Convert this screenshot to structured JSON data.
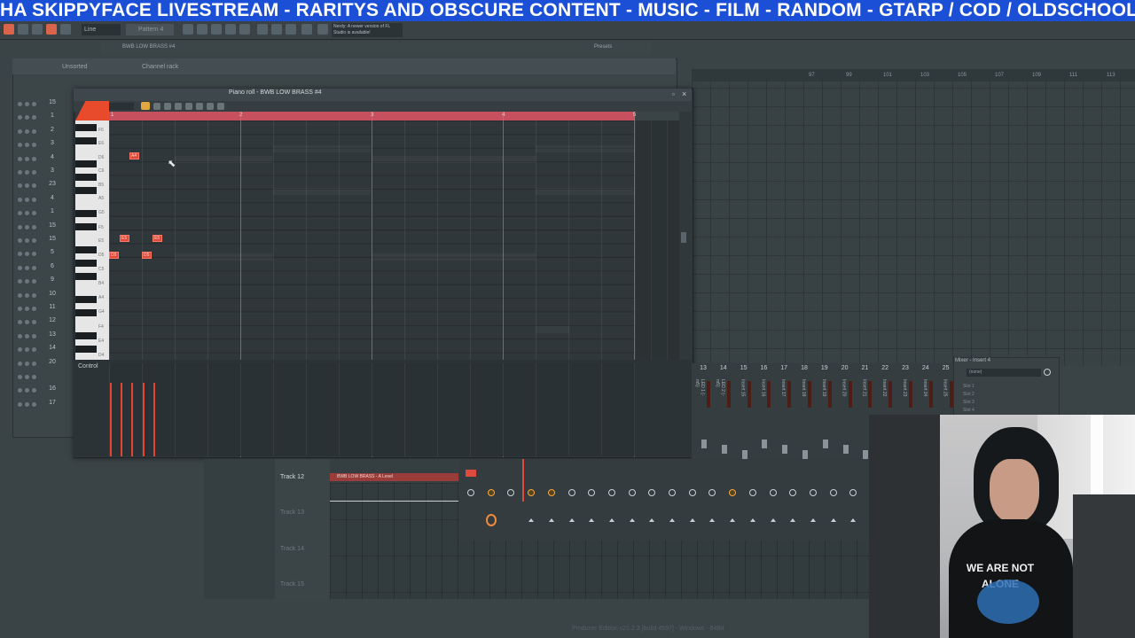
{
  "banner": {
    "text": "HA SKIPPYFACE LIVESTREAM  - RARITYS AND OBSCURE CONTENT - MUSIC - FILM - RANDOM - GTARP / COD / OLDSCHOOL CO"
  },
  "toolbar": {
    "pattern_label": "Pattern 4",
    "mode_label": "Line",
    "news_text": "Nerdy: A newer version of FL Studio is available!"
  },
  "channel_rack": {
    "title": "Channel rack",
    "filter": "Unsorted",
    "sample_window_title": "BWB LOW BRASS #4",
    "presets_label": "Presets",
    "row_numbers": [
      "15",
      "1",
      "2",
      "3",
      "4",
      "3",
      "23",
      "4",
      "1",
      "15",
      "15",
      "5",
      "6",
      "9",
      "10",
      "11",
      "12",
      "13",
      "14",
      "20",
      "",
      "16",
      "17"
    ]
  },
  "piano_roll": {
    "title": "Piano roll - BWB LOW BRASS #4",
    "bar_numbers": [
      "1",
      "2",
      "3",
      "4",
      "5"
    ],
    "key_labels": [
      "F6",
      "E6",
      "D6",
      "C6",
      "B5",
      "A5",
      "G5",
      "F5",
      "E5",
      "D5",
      "C5",
      "B4",
      "A4",
      "G4",
      "F4",
      "E4",
      "D4"
    ],
    "notes": [
      {
        "label": "A4",
        "pitch": "D6"
      },
      {
        "label": "E5",
        "pitch": "F5"
      },
      {
        "label": "E5",
        "pitch": "F5"
      },
      {
        "label": "D5",
        "pitch": "D5"
      },
      {
        "label": "D5",
        "pitch": "D5"
      }
    ],
    "control_label": "Control"
  },
  "mixer": {
    "title": "Mixer - Insert 4",
    "insert_numbers": [
      "13",
      "14",
      "15",
      "16",
      "17",
      "18",
      "19",
      "20",
      "21",
      "22",
      "23",
      "24",
      "25"
    ],
    "insert_labels": [
      "LED 1 (-m5)",
      "LED 2 (-m5)",
      "Insert 15",
      "Insert 16",
      "Insert 17",
      "Insert 18",
      "Insert 19",
      "Insert 20",
      "Insert 21",
      "Insert 22",
      "Insert 23",
      "Insert 24",
      "Insert 25"
    ],
    "slot_label": "(none)",
    "slots": [
      "Slot 1",
      "Slot 2",
      "Slot 3",
      "Slot 4"
    ]
  },
  "playlist": {
    "ruler_numbers": [
      "97",
      "99",
      "101",
      "103",
      "105",
      "107",
      "109",
      "111",
      "113"
    ],
    "tracks": [
      {
        "label": "Track 12",
        "active": true
      },
      {
        "label": "Track 13",
        "active": false
      },
      {
        "label": "Track 14",
        "active": false
      },
      {
        "label": "Track 15",
        "active": false
      }
    ],
    "clip_label": "BWB LOW BRASS - A Level"
  },
  "status_bar": {
    "text": "Producer Edition v21.2.3 [build 4597] - Windows - 64Bit"
  },
  "colors": {
    "banner": "#1a4fd6",
    "note": "#e04a3c",
    "ruler": "#c6505d",
    "accent_orange": "#f2a73a"
  }
}
